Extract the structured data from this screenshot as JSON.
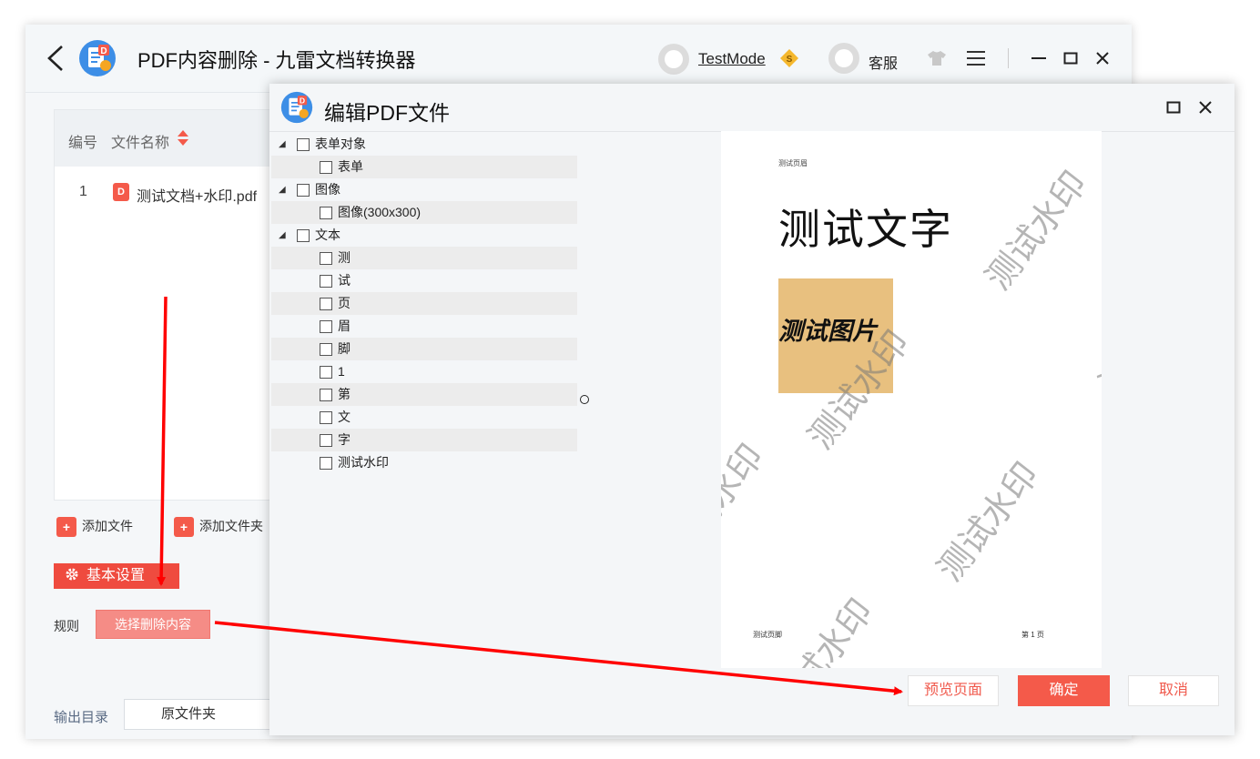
{
  "app": {
    "title": "PDF内容删除 - 九雷文档转换器",
    "user_name": "TestMode",
    "service_label": "客服"
  },
  "file_table": {
    "headers": {
      "number": "编号",
      "name": "文件名称"
    },
    "rows": [
      {
        "number": "1",
        "name": "测试文档+水印.pdf"
      }
    ]
  },
  "actions": {
    "add_file": "添加文件",
    "add_folder": "添加文件夹"
  },
  "settings": {
    "header": "基本设置",
    "rule_label": "规则",
    "select_button": "选择删除内容",
    "output_label": "输出目录",
    "output_value": "原文件夹"
  },
  "dialog": {
    "title": "编辑PDF文件",
    "tree": [
      {
        "label": "表单对象",
        "level": 0
      },
      {
        "label": "表单",
        "level": 1
      },
      {
        "label": "图像",
        "level": 0
      },
      {
        "label": "图像(300x300)",
        "level": 1
      },
      {
        "label": "文本",
        "level": 0
      },
      {
        "label": "测",
        "level": 1
      },
      {
        "label": "试",
        "level": 1
      },
      {
        "label": "页",
        "level": 1
      },
      {
        "label": "眉",
        "level": 1
      },
      {
        "label": "脚",
        "level": 1
      },
      {
        "label": "1",
        "level": 1
      },
      {
        "label": "第",
        "level": 1
      },
      {
        "label": "文",
        "level": 1
      },
      {
        "label": "字",
        "level": 1
      },
      {
        "label": "测试水印",
        "level": 1
      }
    ],
    "preview": {
      "header_text": "测试页眉",
      "big_text": "测试文字",
      "image_text": "测试图片",
      "watermark": "测试水印",
      "footer_left": "测试页脚",
      "footer_right": "第 1 页"
    },
    "buttons": {
      "preview": "预览页面",
      "ok": "确定",
      "cancel": "取消"
    }
  },
  "colors": {
    "accent": "#f45a4a",
    "annotation_arrow": "#ff0000"
  }
}
